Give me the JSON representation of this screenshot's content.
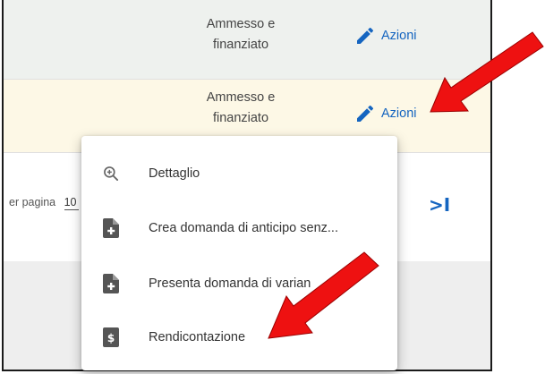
{
  "rows": [
    {
      "status_line1": "Ammesso e",
      "status_line2": "finanziato",
      "action_label": "Azioni"
    },
    {
      "status_line1": "Ammesso e",
      "status_line2": "finanziato",
      "action_label": "Azioni"
    }
  ],
  "pagination": {
    "per_page_label": "er pagina",
    "per_page_value": "10",
    "last_page_glyph": ">I"
  },
  "menu": {
    "items": [
      {
        "label": "Dettaglio",
        "icon": "zoom-in-icon"
      },
      {
        "label": "Crea domanda di anticipo senz...",
        "icon": "file-plus-icon"
      },
      {
        "label": "Presenta domanda di varian",
        "icon": "file-plus-icon"
      },
      {
        "label": "Rendicontazione",
        "icon": "file-dollar-icon"
      }
    ]
  },
  "colors": {
    "accent": "#1565c0",
    "row_hover": "#fdf8e6",
    "annotation_arrow": "#ee1111",
    "icon_grey": "#555555"
  }
}
